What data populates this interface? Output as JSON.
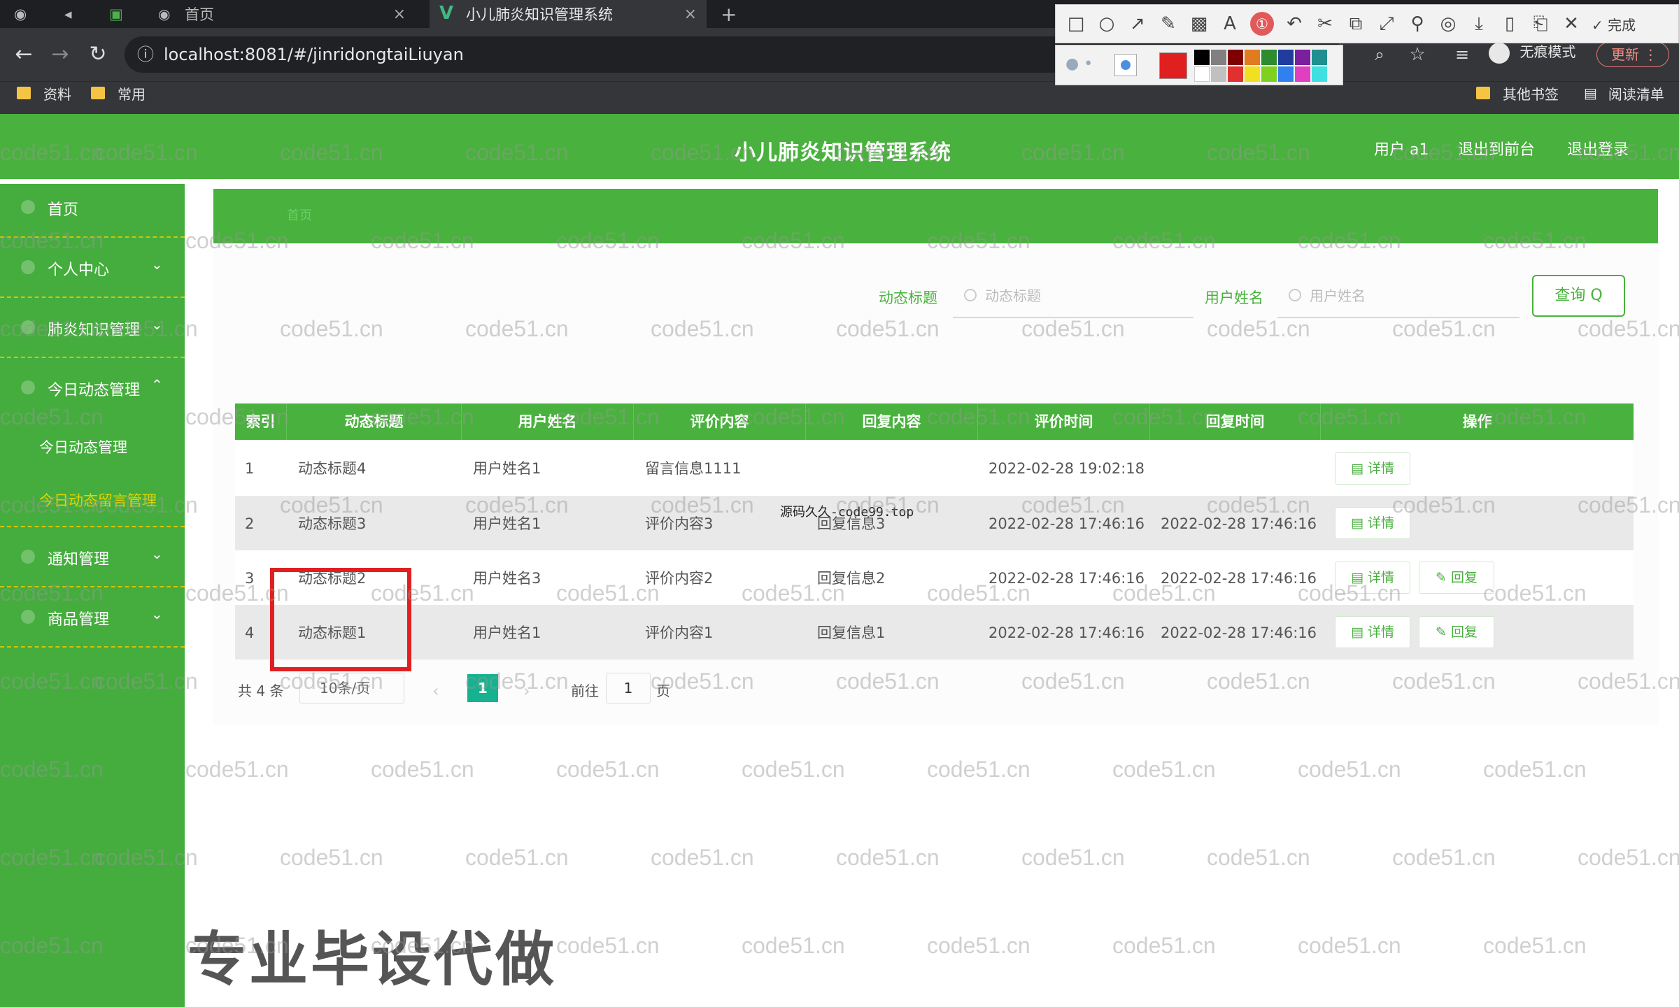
{
  "browser": {
    "tabs": [
      {
        "label": "首页"
      },
      {
        "label": "小儿肺炎知识管理系统"
      }
    ],
    "new_tab": "+",
    "url": "localhost:8081/#/jinridongtaiLiuyan",
    "bookmarks": [
      "资料",
      "常用"
    ],
    "bookmarks_right": [
      "其他书签",
      "阅读清单"
    ],
    "incognito": "无痕模式",
    "update": "更新",
    "snip_done": "完成",
    "snip_text_tool": "A"
  },
  "header": {
    "title": "小儿肺炎知识管理系统",
    "user": "用户 a1",
    "back_to_front": "退出到前台",
    "logout": "退出登录"
  },
  "sidebar": {
    "items": [
      {
        "label": "首页"
      },
      {
        "label": "个人中心"
      },
      {
        "label": "肺炎知识管理"
      },
      {
        "label": "今日动态管理"
      },
      {
        "label": "通知管理"
      },
      {
        "label": "商品管理"
      }
    ],
    "sub": [
      "今日动态管理",
      "今日动态留言管理"
    ]
  },
  "breadcrumb": "首页",
  "filters": {
    "title_label": "动态标题",
    "title_placeholder": "动态标题",
    "user_label": "用户姓名",
    "user_placeholder": "用户姓名",
    "query": "查询 Q"
  },
  "table": {
    "headers": [
      "索引",
      "动态标题",
      "用户姓名",
      "评价内容",
      "回复内容",
      "评价时间",
      "回复时间",
      "操作"
    ],
    "rows": [
      {
        "idx": "1",
        "title": "动态标题4",
        "user": "用户姓名1",
        "content": "留言信息1111",
        "reply": "",
        "time": "2022-02-28 19:02:18",
        "reply_time": ""
      },
      {
        "idx": "2",
        "title": "动态标题3",
        "user": "用户姓名1",
        "content": "评价内容3",
        "reply": "回复信息3",
        "time": "2022-02-28 17:46:16",
        "reply_time": "2022-02-28 17:46:16"
      },
      {
        "idx": "3",
        "title": "动态标题2",
        "user": "用户姓名3",
        "content": "评价内容2",
        "reply": "回复信息2",
        "time": "2022-02-28 17:46:16",
        "reply_time": "2022-02-28 17:46:16"
      },
      {
        "idx": "4",
        "title": "动态标题1",
        "user": "用户姓名1",
        "content": "评价内容1",
        "reply": "回复信息1",
        "time": "2022-02-28 17:46:16",
        "reply_time": "2022-02-28 17:46:16"
      }
    ],
    "detail": "详情",
    "reply_btn": "回复"
  },
  "pager": {
    "total": "共 4 条",
    "size": "10条/页",
    "current": "1",
    "goto_label": "前往",
    "goto_value": "1",
    "page_unit": "页"
  },
  "overlay": {
    "mid_watermark": "源码久久-code99.top",
    "big_watermark": "专业毕设代做",
    "repeat_watermark": "code51.cn"
  },
  "colors": {
    "primary_green": "#49b13d",
    "sidebar_green": "#44ad3d",
    "pager_active": "#16b28f",
    "highlight_red": "#e02020",
    "sidebar_yellow": "#e0d500"
  }
}
